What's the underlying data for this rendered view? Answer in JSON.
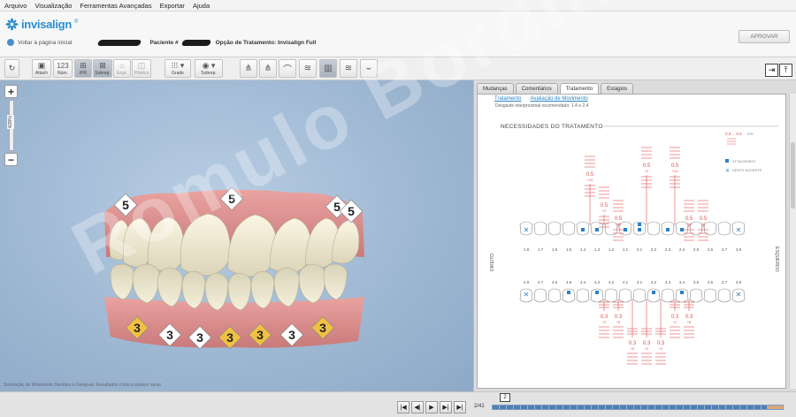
{
  "menu": [
    "Arquivo",
    "Visualização",
    "Ferramentas Avançadas",
    "Exportar",
    "Ajuda"
  ],
  "header": {
    "logo_text": "invisalign",
    "back_link": "Voltar à página inicial",
    "patient_label": "Paciente #",
    "treatment_option": "Opção de Tratamento: Invisalign Full",
    "approve_button": "APROVAR"
  },
  "toolbar": {
    "attach": "Attach",
    "num": "Núm.",
    "num_icon": "123",
    "ipr": "IPR",
    "sobrep": "Sobrep.",
    "engr": "Engr.",
    "pontico": "Pôntico",
    "grade": "Grade",
    "sobrep2": "Sobrep."
  },
  "viewport": {
    "zoom_label": "428%",
    "footer_text": "Simulação de Movimento Dentário e Gengival. Resultados clínicos podem variar.",
    "upper_labels": [
      "5",
      "5",
      "5",
      "5"
    ],
    "lower_labels": [
      "3",
      "3",
      "3",
      "3",
      "3",
      "3",
      "3"
    ]
  },
  "right_panel": {
    "tabs": [
      "Mudanças",
      "Comentários",
      "Tratamento",
      "Estágios"
    ],
    "active_tab": "Tratamento",
    "subtabs": [
      "Tratamento",
      "Avaliação de Movimento"
    ],
    "doc_cut_text": "Desgaste interproximal recomendado: 1.4 e 2.4",
    "section_title": "NECESSIDADES DO TRATAMENTO",
    "legend": {
      "ipr_label": "IPR",
      "ipr_value": "0.3 ... 0.5",
      "attachment_label": "ATTACHMENT",
      "missing_label": "DENTE AUSENTE"
    },
    "side_left": "DIREITO",
    "side_right": "ESQUERDO",
    "upper_numbers": [
      "1.8",
      "1.7",
      "1.6",
      "1.5",
      "1.4",
      "1.3",
      "1.2",
      "1.1",
      "2.1",
      "2.2",
      "2.3",
      "2.4",
      "2.5",
      "2.6",
      "2.7",
      "2.8"
    ],
    "lower_numbers": [
      "4.8",
      "4.7",
      "4.6",
      "4.5",
      "4.4",
      "4.3",
      "4.2",
      "4.1",
      "3.1",
      "3.2",
      "3.3",
      "3.4",
      "3.5",
      "3.6",
      "3.7",
      "3.8"
    ],
    "upper_ipr": [
      {
        "v": "0.5",
        "s": "+10"
      },
      {
        "v": "0.5",
        "s": "+2"
      },
      {
        "v": "0.5",
        "s": "+28"
      },
      {
        "v": "0.5",
        "s": "+2"
      },
      {
        "v": "0.5",
        "s": "+10"
      },
      {
        "v": "0.5",
        "s": "+15"
      },
      {
        "v": "0.5",
        "s": "+8"
      }
    ],
    "lower_ipr": [
      {
        "v": "0.3",
        "s": "+2"
      },
      {
        "v": "0.3",
        "s": "+5"
      },
      {
        "v": "0.3",
        "s": "+5"
      },
      {
        "v": "0.3",
        "s": "+2"
      },
      {
        "v": "0.3",
        "s": "+2"
      },
      {
        "v": "0.3",
        "s": "+2"
      },
      {
        "v": "0.3",
        "s": "+8"
      }
    ]
  },
  "playback": {
    "stage_counter": "2/41",
    "current_stage": "2"
  },
  "watermark": "Romulo Bordin",
  "colors": {
    "accent": "#2a8fd0",
    "ipr_red": "#e05050",
    "attach_blue": "#2a7fc5"
  }
}
